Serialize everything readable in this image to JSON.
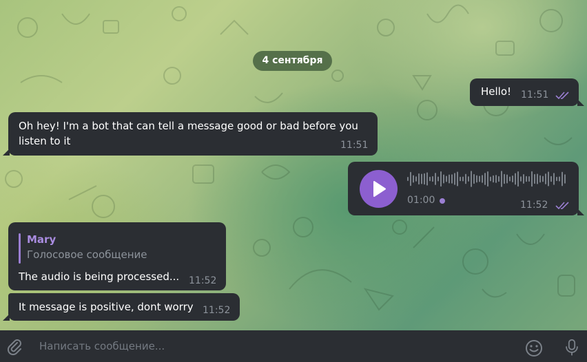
{
  "chat": {
    "date_label": "4 сентября",
    "messages": [
      {
        "id": "m1",
        "direction": "outgoing",
        "text": "Hello!",
        "time": "11:51",
        "read": true
      },
      {
        "id": "m2",
        "direction": "incoming",
        "text_line1": "Oh hey! I'm a bot that can tell a message good or bad before you",
        "text_line2": "listen to it",
        "time": "11:51"
      },
      {
        "id": "m3",
        "direction": "outgoing",
        "type": "voice",
        "duration": "01:00",
        "time": "11:52",
        "read": true
      },
      {
        "id": "m4",
        "direction": "incoming",
        "reply_name": "Mary",
        "reply_preview": "Голосовое сообщение",
        "text": "The audio is being processed...",
        "time": "11:52"
      },
      {
        "id": "m5",
        "direction": "incoming",
        "text": "It message is positive, dont worry",
        "time": "11:52"
      }
    ]
  },
  "composer": {
    "placeholder": "Написать сообщение...",
    "attach_icon": "paperclip-icon",
    "emoji_icon": "emoji-icon",
    "mic_icon": "microphone-icon"
  },
  "colors": {
    "bubble": "#2b2e33",
    "accent": "#8c5fd0",
    "date_pill": "#55704a",
    "time_text": "#8d939b"
  }
}
